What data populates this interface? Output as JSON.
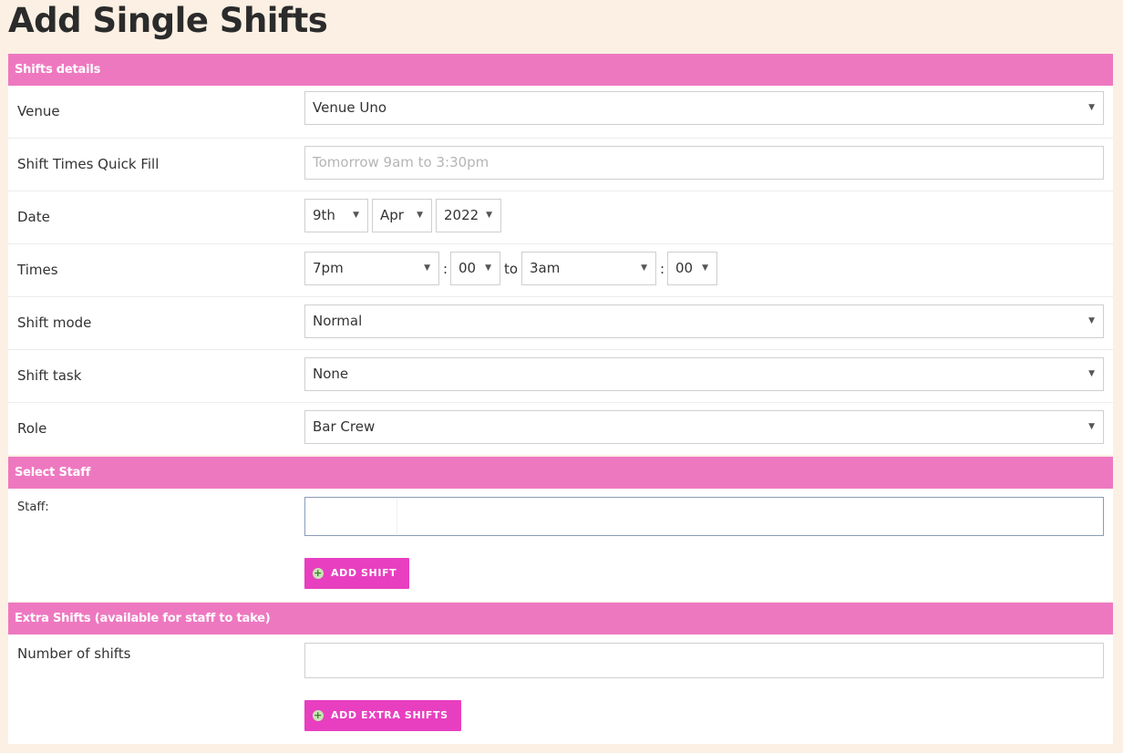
{
  "page_title": "Add Single Shifts",
  "sections": {
    "shift_details": "Shifts details",
    "select_staff": "Select Staff",
    "extra_shifts": "Extra Shifts (available for staff to take)"
  },
  "fields": {
    "venue": {
      "label": "Venue",
      "value": "Venue Uno"
    },
    "quick_fill": {
      "label": "Shift Times Quick Fill",
      "placeholder": "Tomorrow 9am to 3:30pm"
    },
    "date": {
      "label": "Date",
      "day": "9th",
      "month": "Apr",
      "year": "2022"
    },
    "times": {
      "label": "Times",
      "start_hour": "7pm",
      "start_min": "00",
      "colon": ":",
      "to": "to",
      "end_hour": "3am",
      "end_min": "00"
    },
    "shift_mode": {
      "label": "Shift mode",
      "value": "Normal"
    },
    "shift_task": {
      "label": "Shift task",
      "value": "None"
    },
    "role": {
      "label": "Role",
      "value": "Bar Crew"
    },
    "staff": {
      "label": "Staff:"
    },
    "number_of_shifts": {
      "label": "Number of shifts",
      "value": ""
    }
  },
  "buttons": {
    "add_shift": "ADD SHIFT",
    "add_extra_shifts": "ADD EXTRA SHIFTS"
  },
  "icons": {
    "caret": "▼",
    "plus": "+"
  },
  "colors": {
    "section_header": "#ee78c0",
    "button": "#e83fc0",
    "background": "#fbf0e3"
  }
}
